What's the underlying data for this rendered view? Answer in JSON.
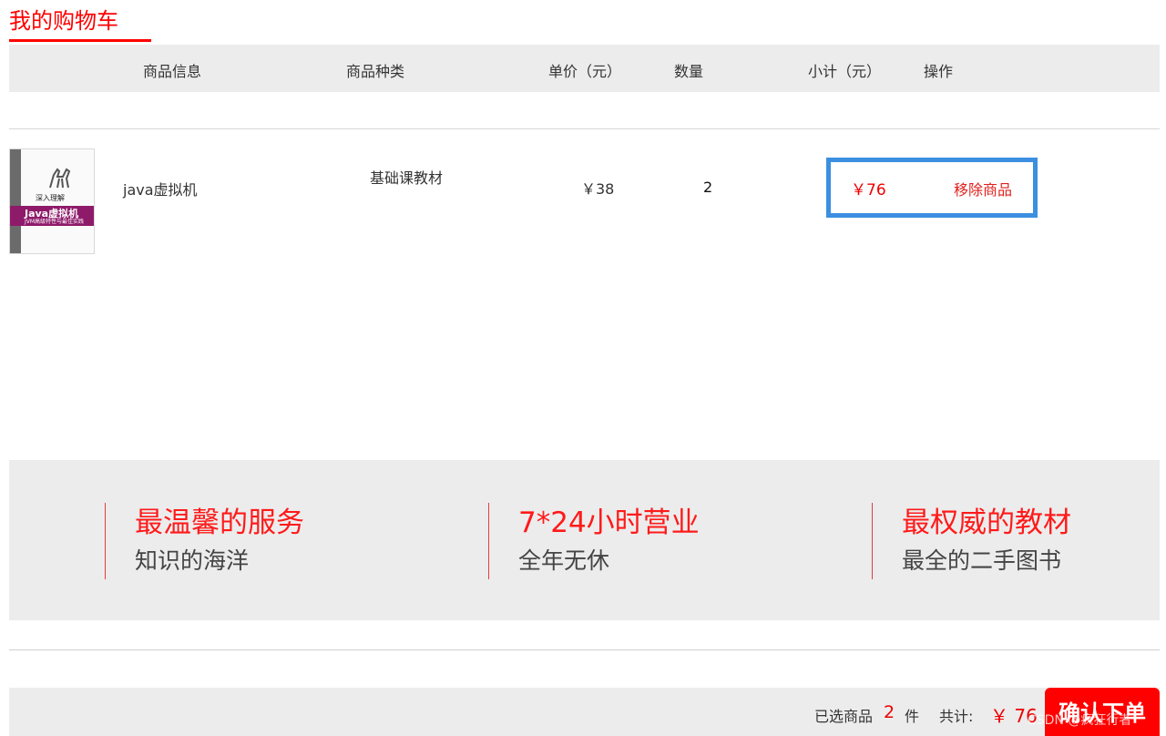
{
  "page": {
    "title": "我的购物车"
  },
  "table_header": {
    "columns": [
      "商品信息",
      "商品种类",
      "单价（元）",
      "数量",
      "小计（元）",
      "操作"
    ]
  },
  "cart_items": [
    {
      "cover_title": "深入理解",
      "cover_subtitle": "Java虚拟机",
      "cover_note": "JVM高级特性与最佳实践",
      "name": "java虚拟机",
      "category": "基础课教材",
      "unit_price": "￥38",
      "quantity": "2",
      "subtotal": "￥76",
      "action": "移除商品"
    }
  ],
  "promos": [
    {
      "title": "最温馨的服务",
      "subtitle": "知识的海洋"
    },
    {
      "title": "7*24小时营业",
      "subtitle": "全年无休"
    },
    {
      "title": "最权威的教材",
      "subtitle": "最全的二手图书"
    }
  ],
  "footer": {
    "selected_label": "已选商品",
    "selected_count": "2",
    "unit": "件",
    "total_label": "共计:",
    "total_value": "￥ 76",
    "confirm_label": "确认下单",
    "watermark": "CSDN @疯狂行者"
  },
  "colors": {
    "accent": "#ff0000",
    "highlight_border": "#3b8fe0",
    "band_bg": "#ececec"
  }
}
